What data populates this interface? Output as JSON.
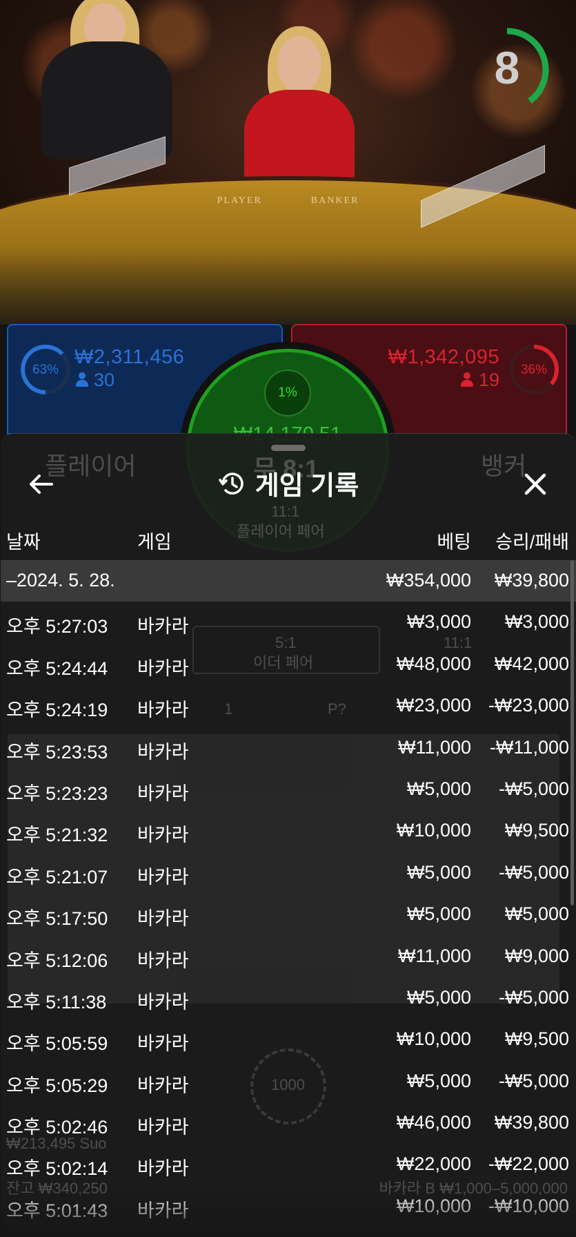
{
  "timer": {
    "value": "8",
    "progress": 0.4,
    "color": "#1ea84a"
  },
  "table_labels": {
    "player": "PLAYER",
    "banker": "BANKER"
  },
  "bets": {
    "player": {
      "percent": "63%",
      "amount": "₩2,311,456",
      "count": "30",
      "color": "#2a72d6"
    },
    "banker": {
      "percent": "36%",
      "amount": "₩1,342,095",
      "count": "19",
      "color": "#d8232e"
    },
    "tie": {
      "percent": "1%",
      "amount": "₩14,170,51",
      "color": "#2fbf2f"
    }
  },
  "history": {
    "title": "게임 기록",
    "icons": {
      "back": "arrow-left-icon",
      "history": "history-clock-icon",
      "close": "close-icon"
    },
    "columns": {
      "date": "날짜",
      "game": "게임",
      "bet": "베팅",
      "result": "승리/패배"
    },
    "summary": {
      "date": "–2024. 5. 28.",
      "bet": "₩354,000",
      "result": "₩39,800"
    },
    "rows": [
      {
        "time": "오후 5:27:03",
        "game": "바카라",
        "bet": "₩3,000",
        "result": "₩3,000"
      },
      {
        "time": "오후 5:24:44",
        "game": "바카라",
        "bet": "₩48,000",
        "result": "₩42,000"
      },
      {
        "time": "오후 5:24:19",
        "game": "바카라",
        "bet": "₩23,000",
        "result": "-₩23,000"
      },
      {
        "time": "오후 5:23:53",
        "game": "바카라",
        "bet": "₩11,000",
        "result": "-₩11,000"
      },
      {
        "time": "오후 5:23:23",
        "game": "바카라",
        "bet": "₩5,000",
        "result": "-₩5,000"
      },
      {
        "time": "오후 5:21:32",
        "game": "바카라",
        "bet": "₩10,000",
        "result": "₩9,500"
      },
      {
        "time": "오후 5:21:07",
        "game": "바카라",
        "bet": "₩5,000",
        "result": "-₩5,000"
      },
      {
        "time": "오후 5:17:50",
        "game": "바카라",
        "bet": "₩5,000",
        "result": "₩5,000"
      },
      {
        "time": "오후 5:12:06",
        "game": "바카라",
        "bet": "₩11,000",
        "result": "₩9,000"
      },
      {
        "time": "오후 5:11:38",
        "game": "바카라",
        "bet": "₩5,000",
        "result": "-₩5,000"
      },
      {
        "time": "오후 5:05:59",
        "game": "바카라",
        "bet": "₩10,000",
        "result": "₩9,500"
      },
      {
        "time": "오후 5:05:29",
        "game": "바카라",
        "bet": "₩5,000",
        "result": "-₩5,000"
      },
      {
        "time": "오후 5:02:46",
        "game": "바카라",
        "bet": "₩46,000",
        "result": "₩39,800"
      },
      {
        "time": "오후 5:02:14",
        "game": "바카라",
        "bet": "₩22,000",
        "result": "-₩22,000"
      },
      {
        "time": "오후 5:01:43",
        "game": "바카라",
        "bet": "₩10,000",
        "result": "-₩10,000"
      }
    ]
  },
  "background_ghost": {
    "player_label": "플레이어",
    "tie_label": "무 8:1",
    "banker_label": "뱅커",
    "pair_ratio": "11:1",
    "player_pair": "플레이어 페어",
    "either_ratio": "5:1",
    "either_pair": "이더 페어",
    "banker_pair_ratio": "11:1",
    "tie_count": "1",
    "p_question": "P?",
    "chip_value": "1000",
    "balance_line1": "₩213,495 Suo",
    "balance_label": "잔고 ₩340,250",
    "limits": "바카라 B ₩1,000–5,000,000"
  }
}
